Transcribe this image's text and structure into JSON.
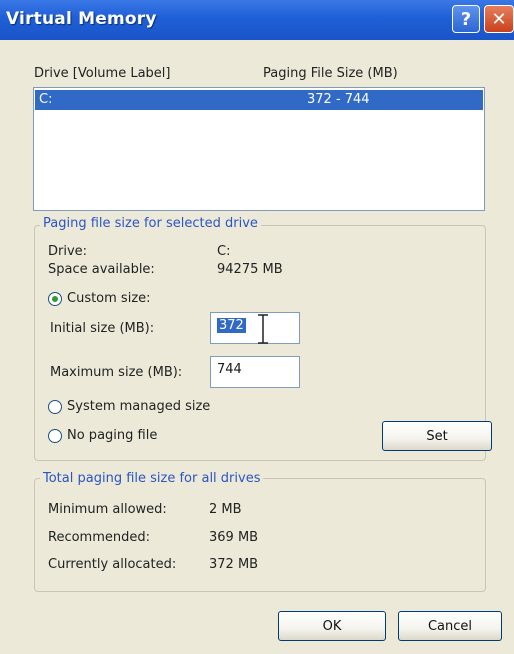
{
  "window": {
    "title": "Virtual Memory",
    "help_glyph": "?",
    "close_glyph": "✕"
  },
  "list": {
    "header_drive": "Drive  [Volume Label]",
    "header_size": "Paging File Size (MB)",
    "rows": [
      {
        "drive": "C:",
        "size": "372 - 744",
        "selected": true
      }
    ]
  },
  "selected_drive_group": {
    "legend": "Paging file size for selected drive",
    "drive_label": "Drive:",
    "drive_value": "C:",
    "space_label": "Space available:",
    "space_value": "94275 MB",
    "custom_label": "Custom size:",
    "initial_label": "Initial size (MB):",
    "initial_value": "372",
    "maximum_label": "Maximum size (MB):",
    "maximum_value": "744",
    "system_label": "System managed size",
    "none_label": "No paging file",
    "selected_option": "custom",
    "set_label": "Set"
  },
  "total_group": {
    "legend": "Total paging file size for all drives",
    "min_label": "Minimum allowed:",
    "min_value": "2 MB",
    "rec_label": "Recommended:",
    "rec_value": "369 MB",
    "alloc_label": "Currently allocated:",
    "alloc_value": "372 MB"
  },
  "footer": {
    "ok_label": "OK",
    "cancel_label": "Cancel"
  }
}
